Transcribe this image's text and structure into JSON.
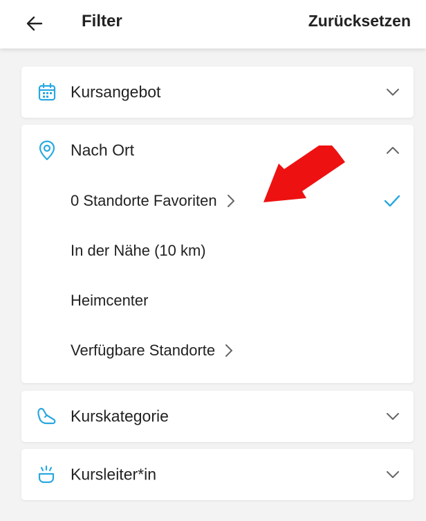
{
  "header": {
    "title": "Filter",
    "reset_label": "Zurücksetzen",
    "back_icon": "arrow-left-icon"
  },
  "sections": {
    "kursangebot": {
      "label": "Kursangebot",
      "icon": "calendar-icon",
      "expanded": false
    },
    "nach_ort": {
      "label": "Nach Ort",
      "icon": "location-pin-icon",
      "expanded": true,
      "options": [
        {
          "label": "0 Standorte Favoriten",
          "has_submenu": true,
          "selected": true
        },
        {
          "label": "In der Nähe (10 km)",
          "has_submenu": false,
          "selected": false
        },
        {
          "label": "Heimcenter",
          "has_submenu": false,
          "selected": false
        },
        {
          "label": "Verfügbare Standorte",
          "has_submenu": true,
          "selected": false
        }
      ]
    },
    "kurskategorie": {
      "label": "Kurskategorie",
      "icon": "shoe-icon",
      "expanded": false
    },
    "kursleiter": {
      "label": "Kursleiter*in",
      "icon": "whistle-icon",
      "expanded": false
    }
  },
  "colors": {
    "accent": "#2aa8e0",
    "annotation_arrow": "#ee1111",
    "background": "#f3f3f3"
  }
}
